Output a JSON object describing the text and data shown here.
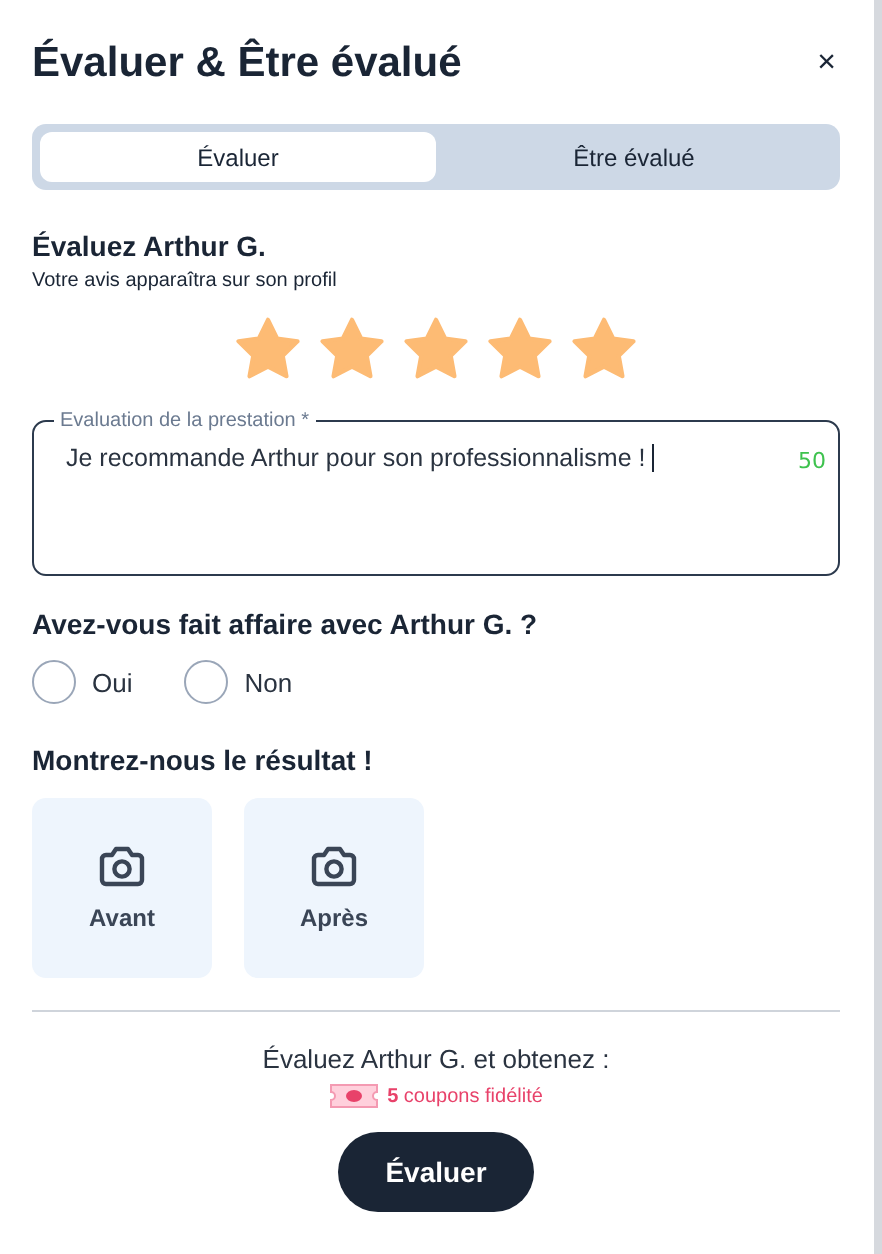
{
  "dialog": {
    "title": "Évaluer & Être évalué",
    "close": "×"
  },
  "tabs": [
    {
      "label": "Évaluer",
      "selected": true
    },
    {
      "label": "Être évalué",
      "selected": false
    }
  ],
  "rating": {
    "heading": "Évaluez Arthur G.",
    "subtitle": "Votre avis apparaîtra sur son profil",
    "stars": 5
  },
  "review": {
    "label": "Evaluation de la prestation *",
    "value": "Je recommande Arthur pour son professionnalisme !",
    "counter": "50"
  },
  "business": {
    "question": "Avez-vous fait affaire avec Arthur G. ?",
    "options": [
      {
        "label": "Oui",
        "selected": false
      },
      {
        "label": "Non",
        "selected": false
      }
    ]
  },
  "photos": {
    "heading": "Montrez-nous le résultat !",
    "slots": [
      {
        "label": "Avant"
      },
      {
        "label": "Après"
      }
    ]
  },
  "reward": {
    "text": "Évaluez Arthur G. et obtenez :",
    "coupon": "**5** coupons fidélité"
  },
  "submit": "Évaluer"
}
